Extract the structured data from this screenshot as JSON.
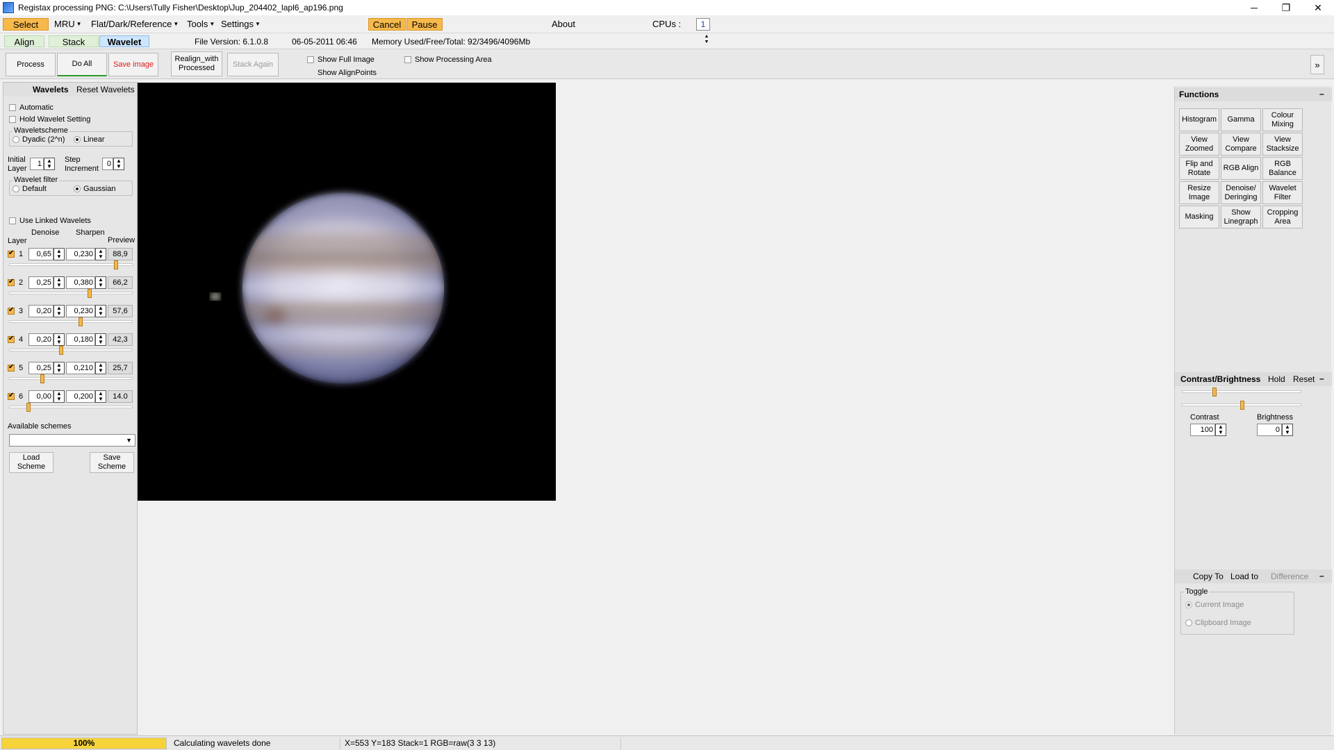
{
  "window": {
    "title": "Registax processing PNG: C:\\Users\\Tully Fisher\\Desktop\\Jup_204402_lapl6_ap196.png",
    "minimize": "─",
    "restore": "❐",
    "close": "✕"
  },
  "menu": {
    "select": "Select",
    "mru": "MRU",
    "flat": "Flat/Dark/Reference",
    "tools": "Tools",
    "settings": "Settings",
    "cancel": "Cancel",
    "pause": "Pause",
    "about": "About",
    "cpus_label": "CPUs :",
    "cpus_value": "1"
  },
  "tabs": {
    "align": "Align",
    "stack": "Stack",
    "wavelet": "Wavelet",
    "file_version": "File Version: 6.1.0.8",
    "date": "06-05-2011 06:46",
    "memory": "Memory Used/Free/Total: 92/3496/4096Mb"
  },
  "toolbar": {
    "process": "Process",
    "do_all": "Do All",
    "save_image": "Save image",
    "realign": "Realign_with Processed",
    "stack_again": "Stack Again",
    "show_full_image": "Show Full Image",
    "show_alignpoints": "Show AlignPoints",
    "show_processing_area": "Show Processing Area",
    "expand": "»"
  },
  "wavelets": {
    "header": "Wavelets",
    "reset": "Reset Wavelets",
    "automatic": "Automatic",
    "hold": "Hold Wavelet Setting",
    "scheme_title": "Waveletscheme",
    "dyadic": "Dyadic (2^n)",
    "linear": "Linear",
    "initial_layer": "Initial Layer",
    "initial_value": "1",
    "step_increment": "Step Increment",
    "step_value": "0",
    "filter_title": "Wavelet filter",
    "filter_default": "Default",
    "filter_gaussian": "Gaussian",
    "use_linked": "Use Linked Wavelets",
    "col_denoise": "Denoise",
    "col_sharpen": "Sharpen",
    "col_layer": "Layer",
    "col_preview": "Preview",
    "layers": [
      {
        "num": "1",
        "denoise": "0,65",
        "sharpen": "0,230",
        "preview": "88,9",
        "level": 0.88
      },
      {
        "num": "2",
        "denoise": "0,25",
        "sharpen": "0,380",
        "preview": "66,2",
        "level": 0.66
      },
      {
        "num": "3",
        "denoise": "0,20",
        "sharpen": "0,230",
        "preview": "57,6",
        "level": 0.58
      },
      {
        "num": "4",
        "denoise": "0,20",
        "sharpen": "0,180",
        "preview": "42,3",
        "level": 0.42
      },
      {
        "num": "5",
        "denoise": "0,25",
        "sharpen": "0,210",
        "preview": "25,7",
        "level": 0.26
      },
      {
        "num": "6",
        "denoise": "0,00",
        "sharpen": "0,200",
        "preview": "14.0",
        "level": 0.14
      }
    ],
    "available_schemes": "Available schemes",
    "load_scheme": "Load Scheme",
    "save_scheme": "Save Scheme"
  },
  "functions": {
    "header": "Functions",
    "collapse": "–",
    "buttons": [
      "Histogram",
      "Gamma",
      "Colour Mixing",
      "View Zoomed",
      "View Compare",
      "View Stacksize",
      "Flip and Rotate",
      "RGB Align",
      "RGB Balance",
      "Resize Image",
      "Denoise/ Deringing",
      "Wavelet Filter",
      "Masking",
      "Show Linegraph",
      "Cropping Area"
    ]
  },
  "contrast": {
    "header": "Contrast/Brightness",
    "hold": "Hold",
    "reset": "Reset",
    "collapse": "–",
    "contrast_label": "Contrast",
    "contrast_value": "100",
    "brightness_label": "Brightness",
    "brightness_value": "0",
    "contrast_level": 0.26,
    "brightness_level": 0.5
  },
  "copy": {
    "copy_to": "Copy To",
    "load_to": "Load to",
    "difference": "Difference",
    "collapse": "–",
    "toggle": "Toggle",
    "current": "Current Image",
    "clipboard": "Clipboard Image"
  },
  "status": {
    "progress": "100%",
    "message": "Calculating wavelets done",
    "coords": "X=553 Y=183 Stack=1 RGB=raw(3 3 13)"
  },
  "colors": {
    "accent_orange": "#f6b94a",
    "tab_active": "#cde6ff",
    "save_red": "#e01a1a"
  }
}
